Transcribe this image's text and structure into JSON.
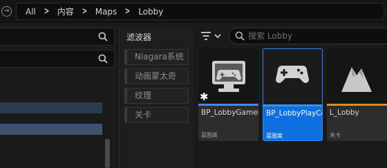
{
  "breadcrumb": {
    "items": [
      "All",
      "内容",
      "Maps",
      "Lobby"
    ]
  },
  "filters": {
    "title": "滤波器",
    "items": [
      "Niagara系统",
      "动画蒙太奇",
      "纹理",
      "关卡"
    ]
  },
  "asset_search": {
    "placeholder": "搜索 Lobby"
  },
  "assets": [
    {
      "name": "BP_LobbyGameMode",
      "type": "蓝图类",
      "icon": "monitor-gamepad-icon",
      "stripe": "#3d8cf0"
    },
    {
      "name": "BP_LobbyPlayController",
      "type": "蓝图类",
      "icon": "gamepad-icon",
      "stripe": "#3d8cf0",
      "selected": true
    },
    {
      "name": "L_Lobby",
      "type": "关卡",
      "icon": "level-icon",
      "stripe": "#e08a1e"
    }
  ],
  "colors": {
    "selection": "#0d6fe0",
    "blueprint_stripe": "#3d8cf0",
    "level_stripe": "#e08a1e"
  }
}
